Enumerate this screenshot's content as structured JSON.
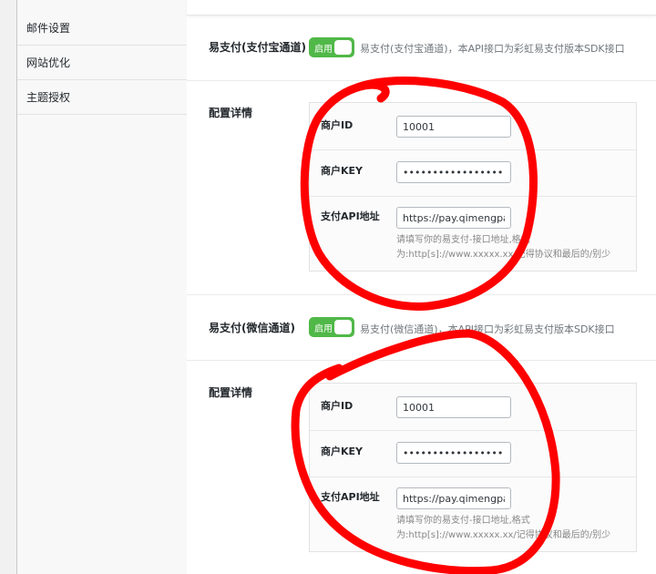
{
  "sidebar": {
    "items": [
      {
        "label": "邮件设置"
      },
      {
        "label": "网站优化"
      },
      {
        "label": "主题授权"
      }
    ]
  },
  "sections": [
    {
      "title": "易支付(支付宝通道)",
      "toggle_label": "启用",
      "description": "易支付(支付宝通道)，本API接口为彩虹易支付版本SDK接口",
      "config_label": "配置详情",
      "fields": {
        "merchant_id": {
          "label": "商户ID",
          "value": "10001"
        },
        "merchant_key": {
          "label": "商户KEY",
          "value": "••••••••••••••••••••"
        },
        "api_url": {
          "label": "支付API地址",
          "value": "https://pay.qimengpay"
        },
        "hint_line1": "请填写你的易支付-接口地址,格式",
        "hint_line2": "为:http[s]://www.xxxxx.xx/记得协议和最后的/别少"
      }
    },
    {
      "title": "易支付(微信通道)",
      "toggle_label": "启用",
      "description": "易支付(微信通道)，本API接口为彩虹易支付版本SDK接口",
      "config_label": "配置详情",
      "fields": {
        "merchant_id": {
          "label": "商户ID",
          "value": "10001"
        },
        "merchant_key": {
          "label": "商户KEY",
          "value": "••••••••••••••••••••"
        },
        "api_url": {
          "label": "支付API地址",
          "value": "https://pay.qimengpay"
        },
        "hint_line1": "请填写你的易支付-接口地址,格式",
        "hint_line2": "为:http[s]://www.xxxxx.xx/记得协议和最后的/别少"
      }
    }
  ],
  "colors": {
    "toggle_on": "#50b848",
    "annotation": "#ff0000"
  }
}
